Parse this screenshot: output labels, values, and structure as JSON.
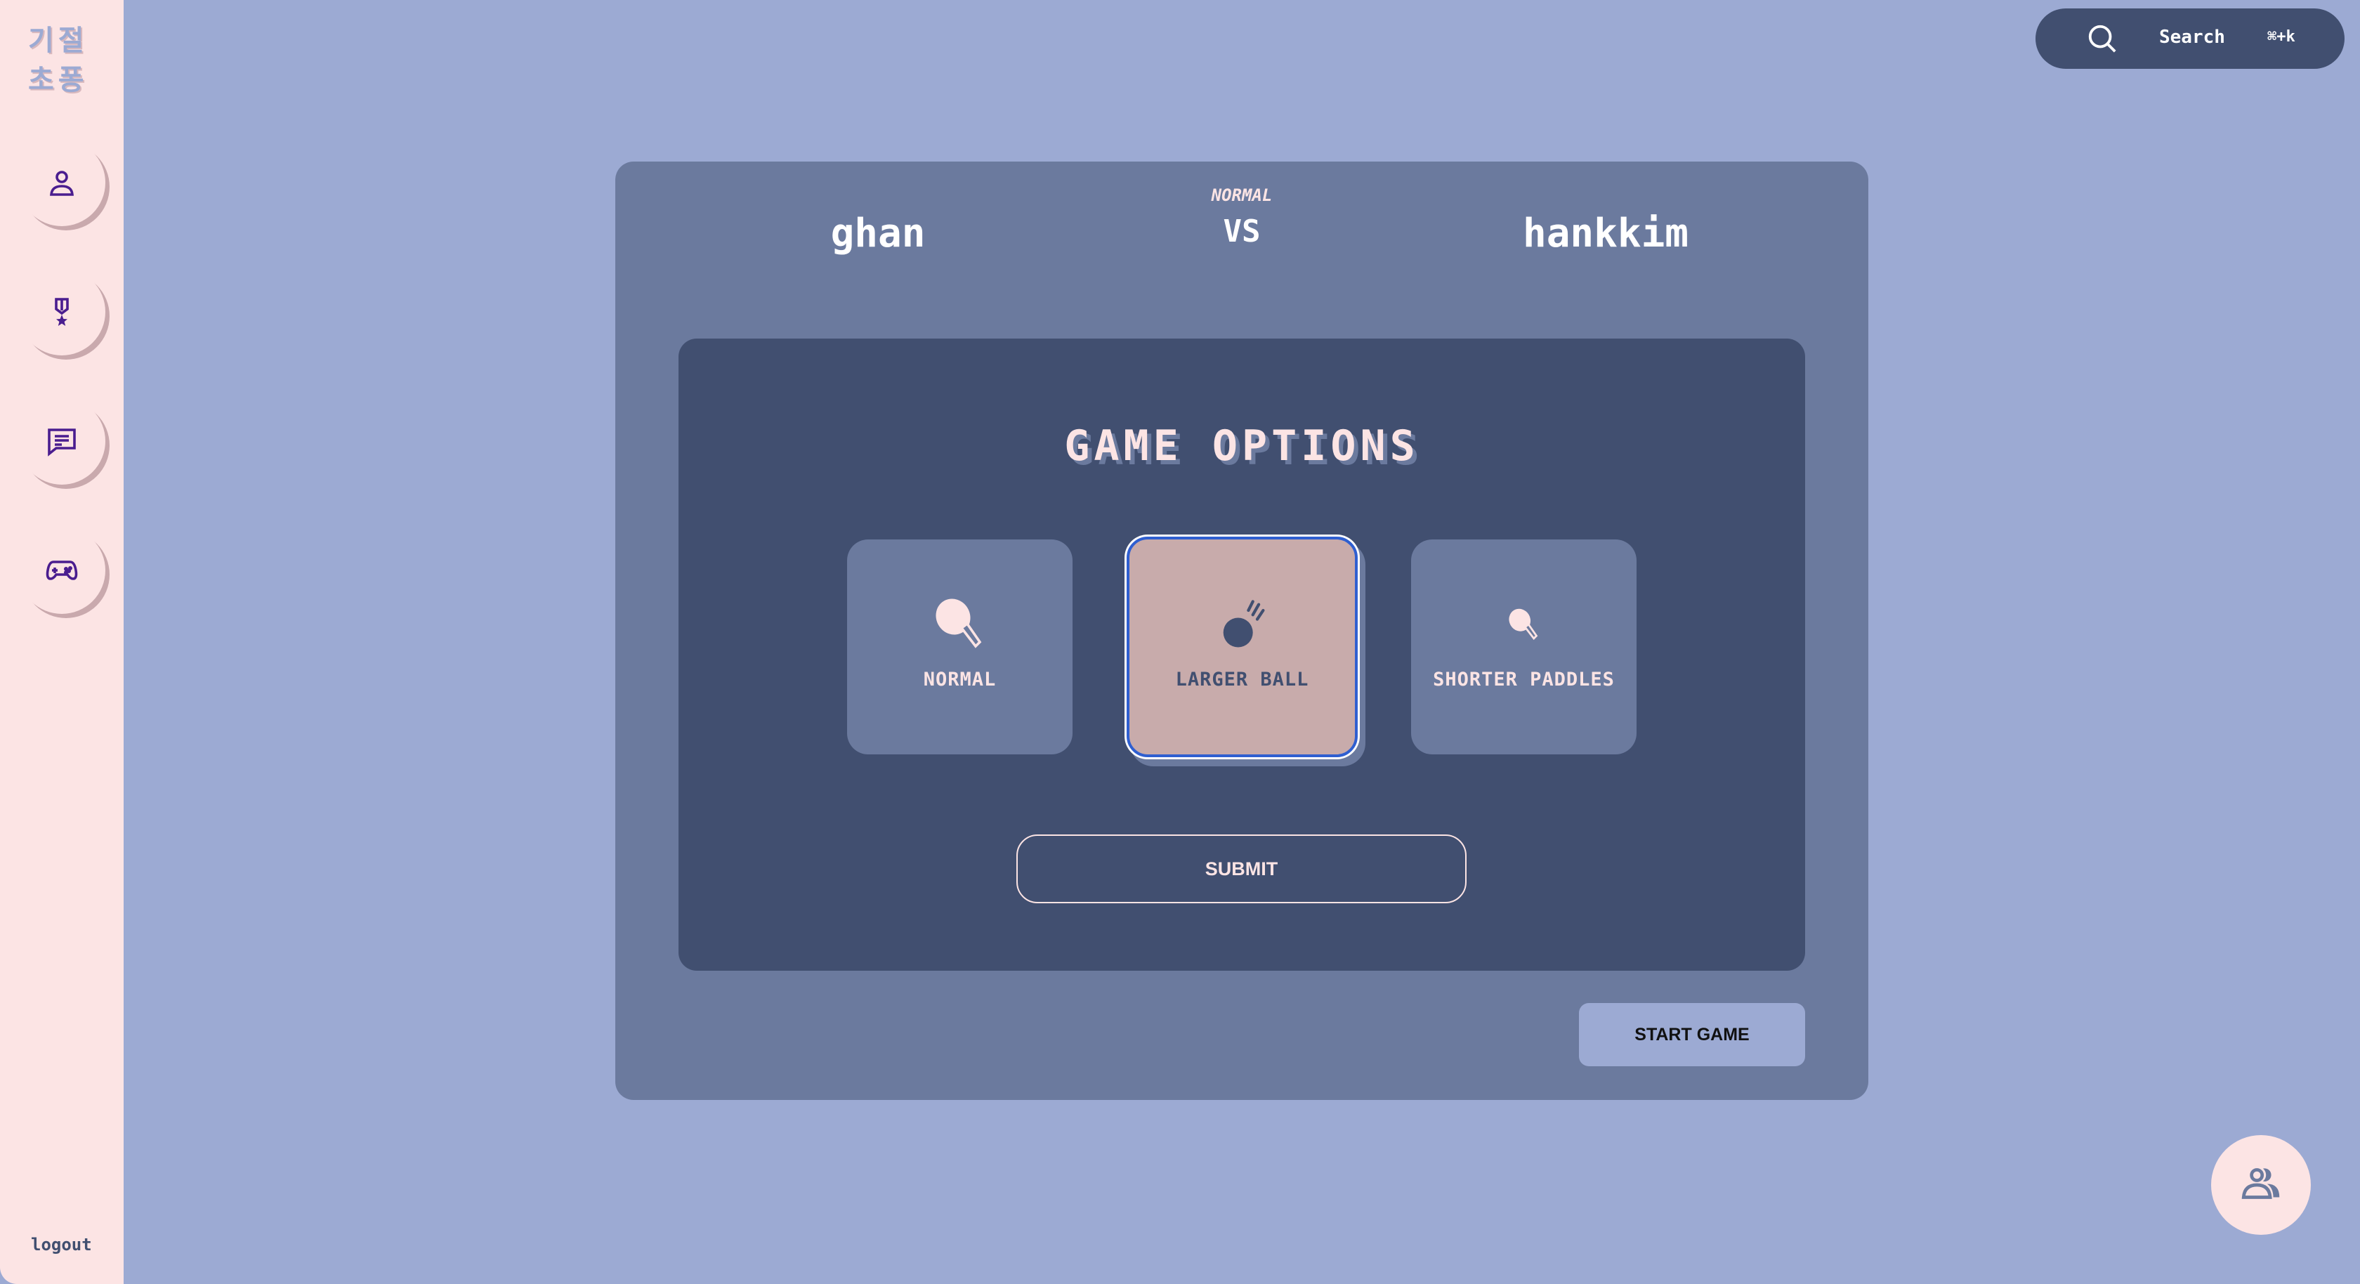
{
  "sidebar": {
    "logo_line1": "기절",
    "logo_line2": "초퐁",
    "nav": [
      {
        "name": "profile",
        "icon": "user-icon"
      },
      {
        "name": "ranking",
        "icon": "medal-icon"
      },
      {
        "name": "chat",
        "icon": "chat-icon"
      },
      {
        "name": "game",
        "icon": "gamepad-icon"
      }
    ],
    "logout_label": "logout"
  },
  "search": {
    "label": "Search",
    "shortcut": "⌘+k"
  },
  "match": {
    "player_left": "ghan",
    "player_right": "hankkim",
    "mode": "NORMAL",
    "vs": "VS"
  },
  "options": {
    "title": "GAME OPTIONS",
    "cards": [
      {
        "label": "NORMAL",
        "icon": "paddle-icon",
        "selected": false
      },
      {
        "label": "LARGER BALL",
        "icon": "ball-icon",
        "selected": true
      },
      {
        "label": "SHORTER PADDLES",
        "icon": "small-paddle-icon",
        "selected": false
      }
    ],
    "submit_label": "SUBMIT"
  },
  "start_label": "START GAME",
  "colors": {
    "background": "#9caad3",
    "sidebar": "#fce4e4",
    "panel": "#6b7a9e",
    "inner_panel": "#414f70",
    "selected_card": "#c8abab",
    "selected_border": "#2f5fd0",
    "icon_purple": "#4a1d8f"
  }
}
